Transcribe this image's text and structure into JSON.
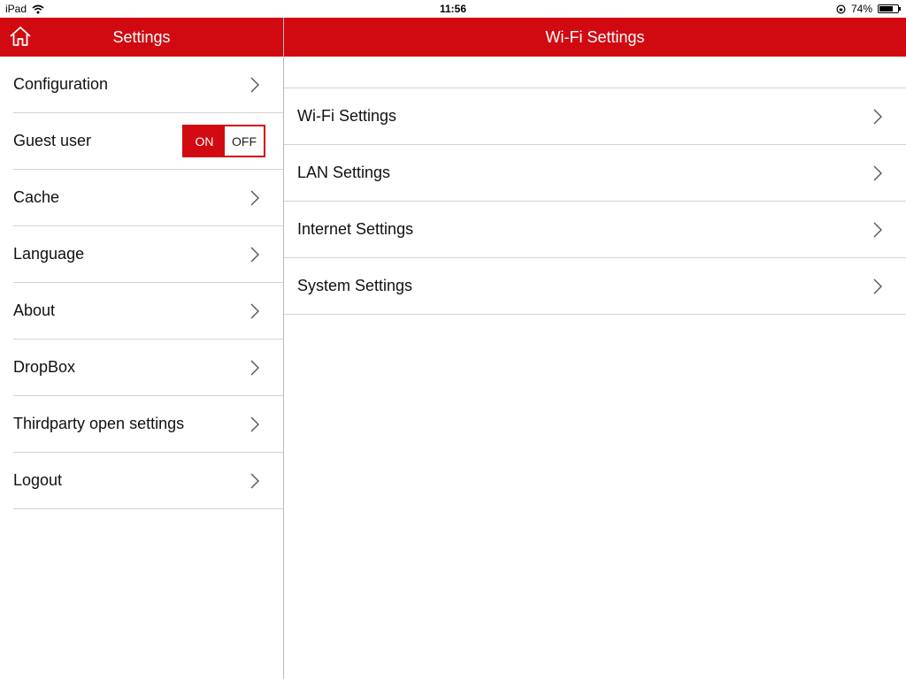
{
  "status_bar": {
    "device": "iPad",
    "time": "11:56",
    "battery_percent": "74%",
    "battery_level": 0.74
  },
  "left_header": {
    "title": "Settings",
    "home_icon": "home-icon"
  },
  "right_header": {
    "title": "Wi-Fi Settings"
  },
  "left_menu": {
    "items": [
      {
        "label": "Configuration"
      },
      {
        "label": "Guest user"
      },
      {
        "label": "Cache"
      },
      {
        "label": "Language"
      },
      {
        "label": "About"
      },
      {
        "label": "DropBox"
      },
      {
        "label": "Thirdparty open settings"
      },
      {
        "label": "Logout"
      }
    ],
    "guest_toggle": {
      "on_label": "ON",
      "off_label": "OFF",
      "state": "on"
    }
  },
  "right_menu": {
    "items": [
      {
        "label": "Wi-Fi Settings"
      },
      {
        "label": "LAN Settings"
      },
      {
        "label": "Internet Settings"
      },
      {
        "label": "System Settings"
      }
    ]
  },
  "colors": {
    "accent": "#d10a11",
    "divider": "#d3d3d3"
  }
}
